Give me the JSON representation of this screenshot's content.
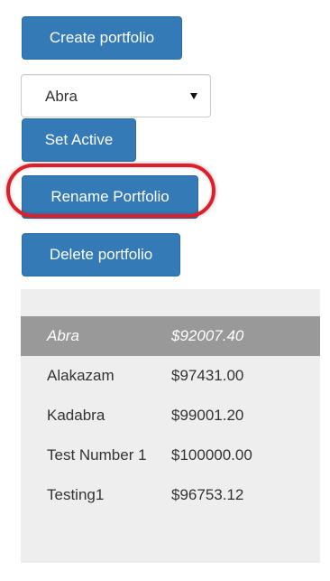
{
  "buttons": {
    "create_label": "Create portfolio",
    "set_active_label": "Set Active",
    "rename_label": "Rename Portfolio",
    "delete_label": "Delete portfolio"
  },
  "portfolio_select": {
    "selected_value": "Abra"
  },
  "portfolio_list": {
    "active_index": 0,
    "items": [
      {
        "name": "Abra",
        "value": "$92007.40"
      },
      {
        "name": "Alakazam",
        "value": "$97431.00"
      },
      {
        "name": "Kadabra",
        "value": "$99001.20"
      },
      {
        "name": "Test Number 1",
        "value": "$100000.00"
      },
      {
        "name": "Testing1",
        "value": "$96753.12"
      }
    ]
  },
  "colors": {
    "button_primary": "#337ab7",
    "active_row": "#999999",
    "panel_background": "#eeeeee",
    "highlight_ring": "#e01e2a"
  }
}
